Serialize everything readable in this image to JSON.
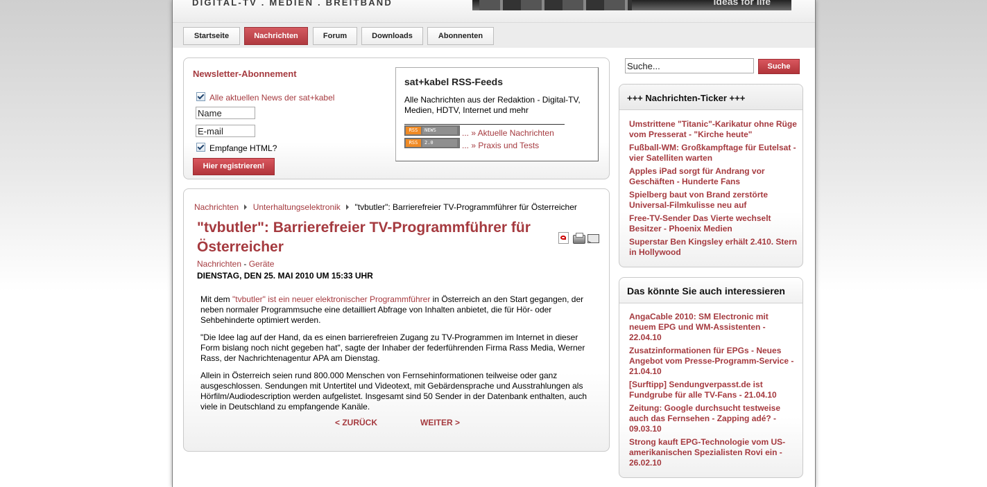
{
  "header": {
    "tagline": "DIGITAL-TV . MEDIEN . BREITBAND",
    "banner_slogan": "ideas for life"
  },
  "nav": {
    "tabs": [
      {
        "label": "Startseite",
        "active": false
      },
      {
        "label": "Nachrichten",
        "active": true
      },
      {
        "label": "Forum",
        "active": false
      },
      {
        "label": "Downloads",
        "active": false
      },
      {
        "label": "Abonnenten",
        "active": false
      }
    ]
  },
  "newsletter": {
    "title": "Newsletter-Abonnement",
    "all_news_label": "Alle aktuellen News der sat+kabel",
    "name_value": "Name",
    "email_value": "E-mail",
    "html_label": "Empfange HTML?",
    "register_label": "Hier registrieren!"
  },
  "rss": {
    "title": "sat+kabel RSS-Feeds",
    "description": "Alle Nachrichten aus der Redaktion - Digital-TV, Medien, HDTV, Internet und mehr",
    "feeds": [
      {
        "badge_left": "RSS",
        "badge_right": "NEWS",
        "label": "... » Aktuelle Nachrichten"
      },
      {
        "badge_left": "RSS",
        "badge_right": "2.0",
        "label": "... » Praxis und Tests"
      }
    ]
  },
  "search": {
    "value": "Suche...",
    "button_label": "Suche"
  },
  "article": {
    "breadcrumb": [
      "Nachrichten",
      "Unterhaltungselektronik",
      "\"tvbutler\": Barrierefreier TV-Programmführer für Österreicher"
    ],
    "title": "\"tvbutler\": Barrierefreier TV-Programmführer für Österreicher",
    "category": "Nachrichten",
    "category_sep": " - ",
    "subcategory": "Geräte",
    "date": "DIENSTAG, DEN 25. MAI 2010 UM 15:33 UHR",
    "p1_start": "Mit dem ",
    "p1_link": "\"tvbutler\" ist ein neuer elektronischer Programmführer",
    "p1_end": " in Österreich an den Start gegangen, der neben normaler Programmsuche eine detailliert Abfrage von Inhalten anbietet, die für Hör- oder Sehbehinderte optimiert werden.",
    "p2": "\"Die Idee lag auf der Hand, da es einen barrierefreien Zugang zu TV-Programmen im Internet in dieser Form bislang noch nicht gegeben hat\", sagte der Inhaber der federführenden Firma Rass Media, Werner Rass, der Nachrichtenagentur APA am Dienstag.",
    "p3": "Allein in Österreich seien rund 800.000 Menschen von Fernsehinformationen teilweise oder ganz ausgeschlossen. Sendungen mit Untertitel und Videotext, mit Gebärdensprache und Ausstrahlungen als Hörfilm/Audiodescription werden aufgelistet. Insgesamt sind 50 Sender in der Datenbank enthalten, auch viele in Deutschland zu empfangende Kanäle.",
    "prev_label": "< ZURÜCK",
    "next_label": "WEITER >"
  },
  "ticker": {
    "title": "+++ Nachrichten-Ticker +++",
    "items": [
      "Umstrittene \"Titanic\"-Karikatur ohne Rüge vom Presserat - \"Kirche heute\"",
      "Fußball-WM: Großkampftage für Eutelsat - vier Satelliten warten",
      "Apples iPad sorgt für Andrang vor Geschäften - Hunderte Fans",
      "Spielberg baut von Brand zerstörte Universal-Filmkulisse neu auf",
      "Free-TV-Sender Das Vierte wechselt Besitzer - Phoenix Medien",
      "Superstar Ben Kingsley erhält 2.410. Stern in Hollywood"
    ]
  },
  "related": {
    "title": "Das könnte Sie auch interessieren",
    "items": [
      "AngaCable 2010: SM Electronic mit neuem EPG und WM-Assistenten - 22.04.10",
      "Zusatzinformationen für EPGs - Neues Angebot vom Presse-Programm-Service - 21.04.10",
      "[Surftipp] Sendungverpasst.de ist Fundgrube für alle TV-Fans - 21.04.10",
      "Zeitung: Google durchsucht testweise auch das Fernsehen - Zapping adé? - 09.03.10",
      "Strong kauft EPG-Technologie vom US-amerikanischen Spezialisten Rovi ein - 26.02.10"
    ]
  }
}
